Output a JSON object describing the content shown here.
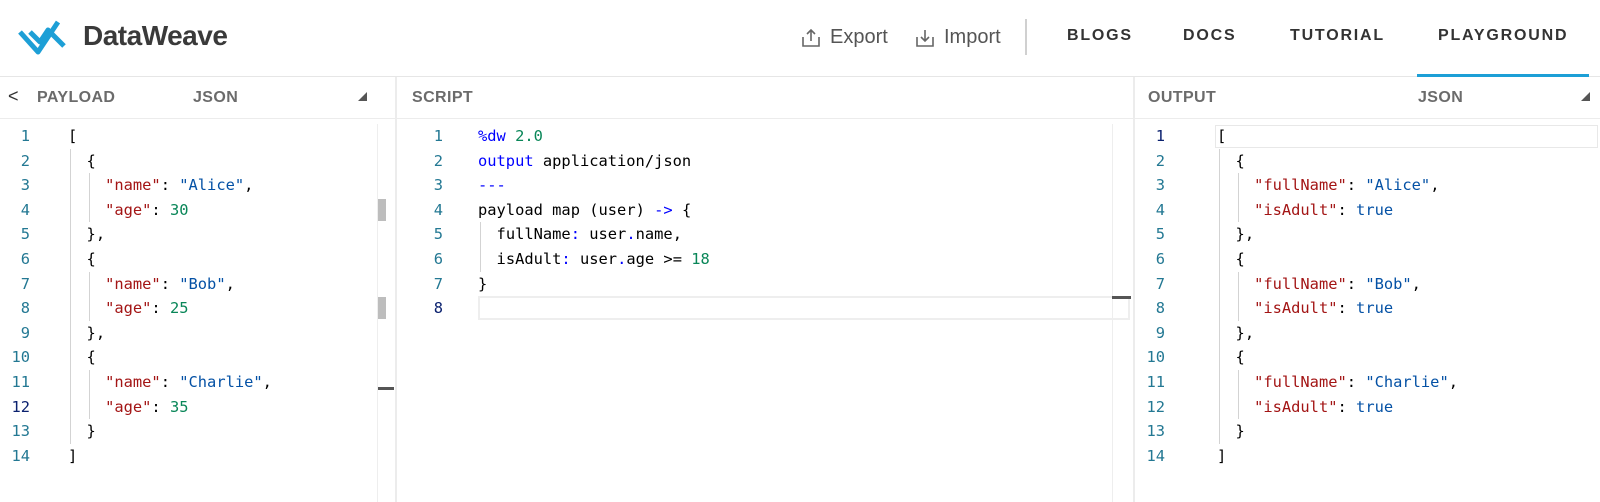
{
  "header": {
    "brand": "DataWeave",
    "export_label": "Export",
    "import_label": "Import",
    "nav": [
      {
        "label": "BLOGS"
      },
      {
        "label": "DOCS"
      },
      {
        "label": "TUTORIAL"
      },
      {
        "label": "PLAYGROUND",
        "active": true
      }
    ],
    "accent_color": "#1d9fd6"
  },
  "payload": {
    "title": "PAYLOAD",
    "format": "JSON",
    "collapse_glyph": "<",
    "lines": [
      "[",
      "  {",
      "    \"name\": \"Alice\",",
      "    \"age\": 30",
      "  },",
      "  {",
      "    \"name\": \"Bob\",",
      "    \"age\": 25",
      "  },",
      "  {",
      "    \"name\": \"Charlie\",",
      "    \"age\": 35",
      "  }",
      "]"
    ],
    "current_line": 12
  },
  "script": {
    "title": "SCRIPT",
    "lines": [
      "%dw 2.0",
      "output application/json",
      "---",
      "payload map (user) -> {",
      "  fullName: user.name,",
      "  isAdult: user.age >= 18",
      "}",
      ""
    ],
    "current_line": 8
  },
  "output": {
    "title": "OUTPUT",
    "format": "JSON",
    "lines": [
      "[",
      "  {",
      "    \"fullName\": \"Alice\",",
      "    \"isAdult\": true",
      "  },",
      "  {",
      "    \"fullName\": \"Bob\",",
      "    \"isAdult\": true",
      "  },",
      "  {",
      "    \"fullName\": \"Charlie\",",
      "    \"isAdult\": true",
      "  }",
      "]"
    ],
    "current_line": 1
  }
}
